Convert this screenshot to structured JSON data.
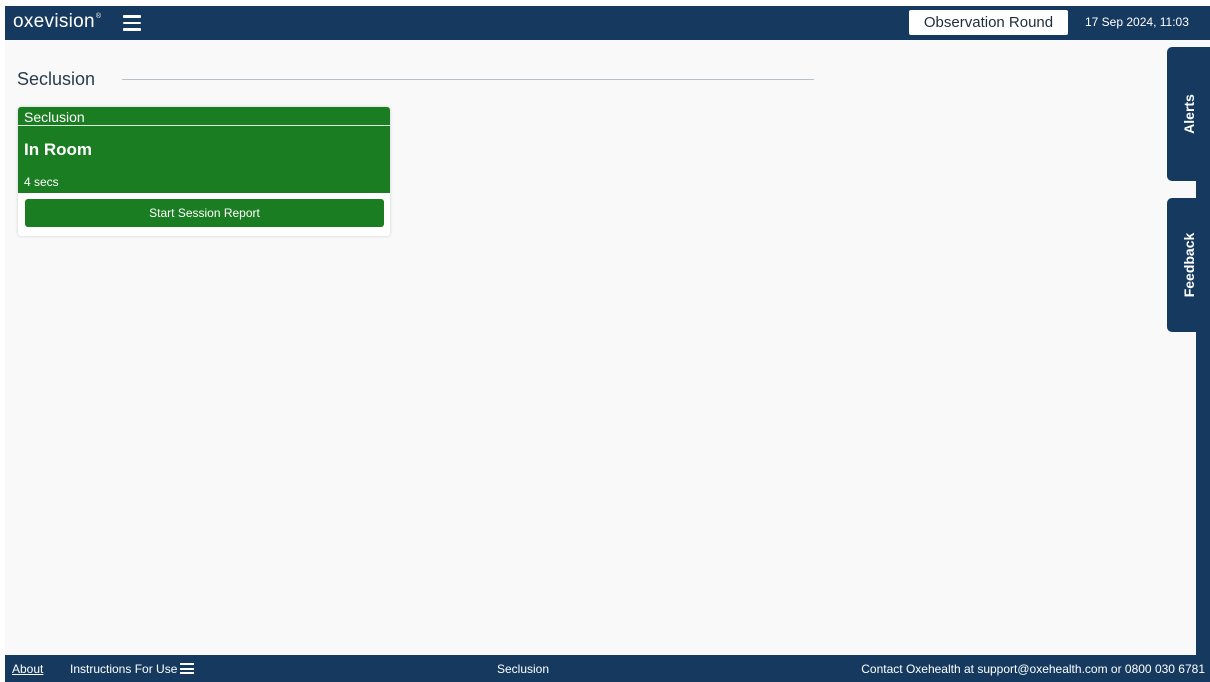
{
  "header": {
    "logo_text": "oxevision",
    "logo_mark": "®",
    "menu_icon": "hamburger-menu-icon",
    "observation_round_label": "Observation Round",
    "datetime": "17 Sep 2024, 11:03"
  },
  "main": {
    "section_title": "Seclusion",
    "rooms": [
      {
        "name": "Seclusion",
        "state": "In Room",
        "duration": "4 secs",
        "action_label": "Start Session Report",
        "status_color": "#1b7d22"
      }
    ]
  },
  "side_tabs": {
    "alerts_label": "Alerts",
    "feedback_label": "Feedback"
  },
  "footer": {
    "about_label": "About",
    "ifu_label": "Instructions For Use",
    "ifu_icon": "hamburger-menu-icon",
    "center_label": "Seclusion",
    "contact_text": "Contact Oxehealth at support@oxehealth.com or 0800 030 6781"
  },
  "colors": {
    "brand_navy": "#163a5f",
    "status_green": "#1b7d22",
    "background": "#f9f9f9"
  }
}
